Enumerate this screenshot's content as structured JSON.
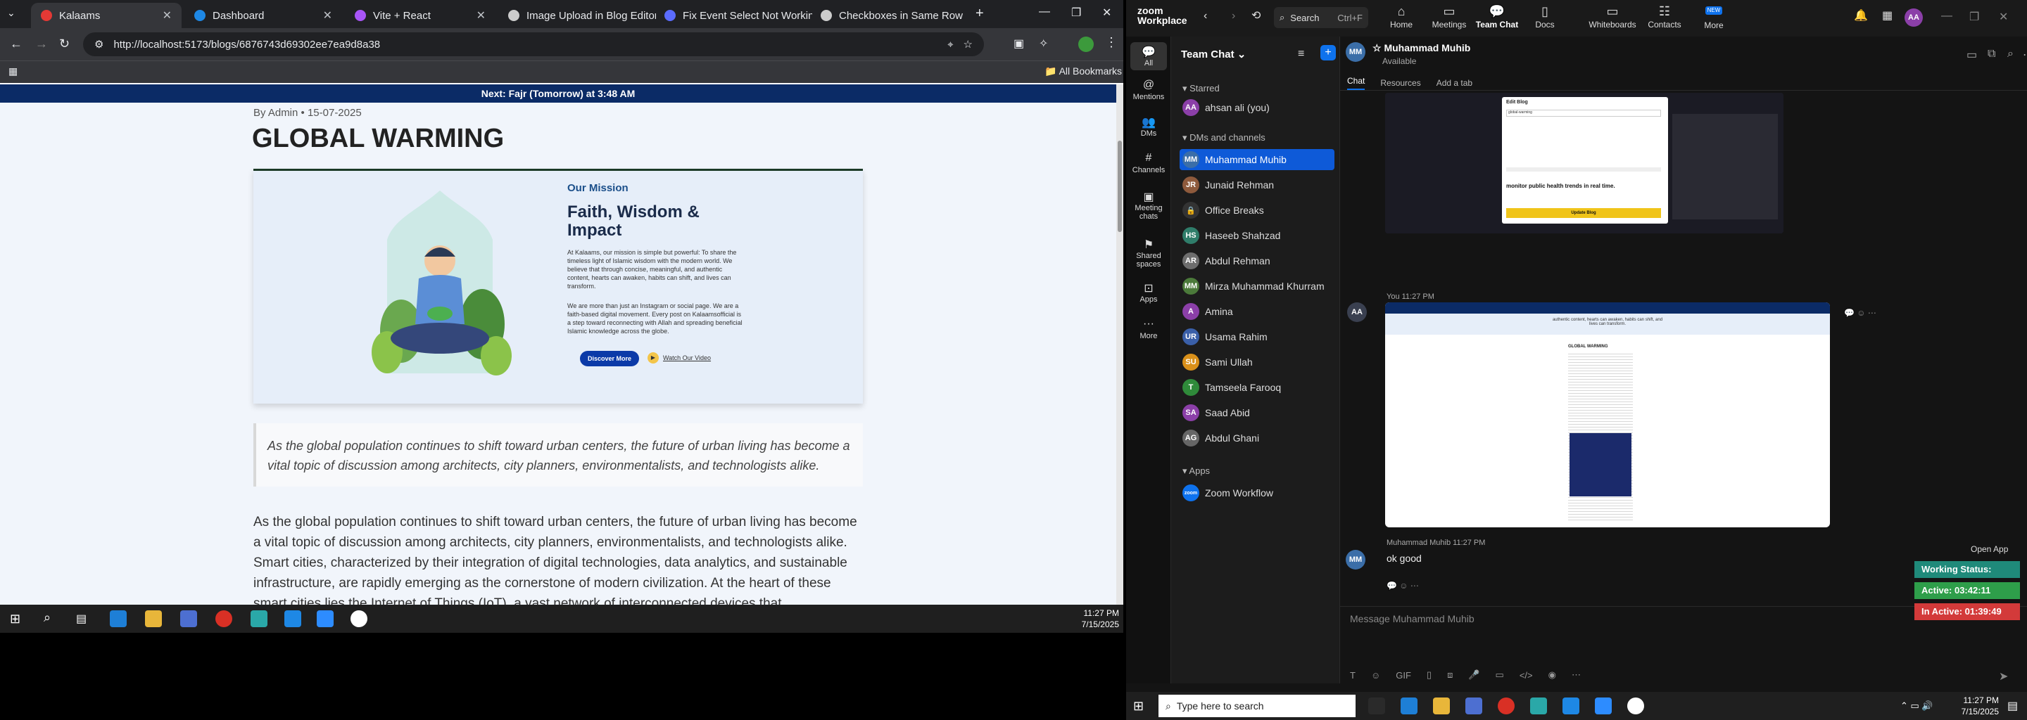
{
  "browser": {
    "tabs": [
      {
        "label": "Kalaams",
        "color": "#e53935"
      },
      {
        "label": "Dashboard",
        "color": "#1e88e5"
      },
      {
        "label": "Vite + React",
        "color": "#a855f7"
      },
      {
        "label": "Image Upload in Blog Editor",
        "color": "#cccccc"
      },
      {
        "label": "Fix Event Select Not Working",
        "color": "#5b6cff"
      },
      {
        "label": "Checkboxes in Same Row",
        "color": "#cccccc"
      }
    ],
    "new_tab": "+",
    "url": "http://localhost:5173/blogs/6876743d69302ee7ea9d8a38",
    "all_bookmarks": "All Bookmarks"
  },
  "site": {
    "notice": "Next: Fajr (Tomorrow) at 3:48 AM",
    "meta": "By Admin • 15-07-2025",
    "title": "GLOBAL WARMING",
    "hero": {
      "eyebrow": "Our Mission",
      "heading": "Faith, Wisdom & Impact",
      "para1": "At Kalaams, our mission is simple but powerful: To share the timeless light of Islamic wisdom with the modern world. We believe that through concise, meaningful, and authentic content, hearts can awaken, habits can shift, and lives can transform.",
      "para2": "We are more than just an Instagram or social page. We are a faith-based digital movement. Every post on Kalaamsofficial is a step toward reconnecting with Allah and spreading beneficial Islamic knowledge across the globe.",
      "btn_discover": "Discover More",
      "btn_watch": "Watch Our Video"
    },
    "quote": "As the global population continues to shift toward urban centers, the future of urban living has become a vital topic of discussion among architects, city planners, environmentalists, and technologists alike.",
    "body": "As the global population continues to shift toward urban centers, the future of urban living has become a vital topic of discussion among architects, city planners, environmentalists, and technologists alike. Smart cities, characterized by their integration of digital technologies, data analytics, and sustainable infrastructure, are rapidly emerging as the cornerstone of modern civilization. At the heart of these smart cities lies the Internet of Things (IoT), a vast network of interconnected devices that communicate with one another to"
  },
  "taskbar1": {
    "time": "11:27 PM",
    "date": "7/15/2025"
  },
  "zoom": {
    "brand": "zoom Workplace",
    "search": "Search",
    "shortcut": "Ctrl+F",
    "nav": [
      "Home",
      "Meetings",
      "Team Chat",
      "Docs",
      "Whiteboards",
      "Contacts",
      "More"
    ],
    "new_badge": "NEW",
    "avatar": "AA",
    "rail": [
      "All",
      "Mentions",
      "DMs",
      "Channels",
      "Meeting chats",
      "Shared spaces",
      "Apps",
      "More"
    ],
    "list_title": "Team Chat",
    "sections": {
      "starred": "Starred",
      "dms": "DMs and channels",
      "apps": "Apps"
    },
    "starred_item": {
      "name": "ahsan ali (you)",
      "initials": "AA"
    },
    "contacts": [
      {
        "name": "Muhammad Muhib",
        "initials": "MM",
        "color": "#3b6ea8"
      },
      {
        "name": "Junaid Rehman",
        "initials": "JR",
        "color": "#8e5a3c"
      },
      {
        "name": "Office Breaks",
        "initials": "🔒",
        "color": "#333333"
      },
      {
        "name": "Haseeb Shahzad",
        "initials": "HS",
        "color": "#2f7d6a"
      },
      {
        "name": "Abdul Rehman",
        "initials": "AR",
        "color": "#6d6d6d"
      },
      {
        "name": "Mirza Muhammad Khurram",
        "initials": "MM",
        "color": "#4b7a3a"
      },
      {
        "name": "Amina",
        "initials": "A",
        "color": "#8b3fa8"
      },
      {
        "name": "Usama Rahim",
        "initials": "UR",
        "color": "#3a5fa8"
      },
      {
        "name": "Sami Ullah",
        "initials": "SU",
        "color": "#d9901a"
      },
      {
        "name": "Tamseela Farooq",
        "initials": "T",
        "color": "#2f8a3a"
      },
      {
        "name": "Saad Abid",
        "initials": "SA",
        "color": "#8b3fa8"
      },
      {
        "name": "Abdul Ghani",
        "initials": "AG",
        "color": "#666666"
      }
    ],
    "app_item": {
      "name": "Zoom Workflow",
      "initials": "zoom"
    },
    "chat": {
      "contact": "Muhammad Muhib",
      "initials": "MM",
      "status": "Available",
      "tabs": [
        "Chat",
        "Resources",
        "Add a tab"
      ],
      "sender_you": "You",
      "time_you": "11:27 PM",
      "sender2": "Muhammad Muhib",
      "time2": "11:27 PM",
      "message2": "ok good",
      "open_app": "Open App",
      "compose_placeholder": "Message Muhammad Muhib"
    },
    "shot1": {
      "dialog_title": "Edit Blog",
      "field": "global-warming",
      "text": "monitor public health trends in real time.",
      "button": "Update Blog"
    },
    "shot2": {
      "line1": "authentic content, hearts can awaken, habits can shift, and",
      "line2": "lives can transform.",
      "heading": "GLOBAL WARMING"
    }
  },
  "status_widget": {
    "working": "Working Status: Active",
    "active": "Active: 03:42:11",
    "inactive": "In Active: 01:39:49",
    "colors": {
      "working": "#1f8a7a",
      "active": "#2e9e4a",
      "inactive": "#d33a3a"
    }
  },
  "taskbar2": {
    "search": "Type here to search",
    "time": "11:27 PM",
    "date": "7/15/2025"
  }
}
